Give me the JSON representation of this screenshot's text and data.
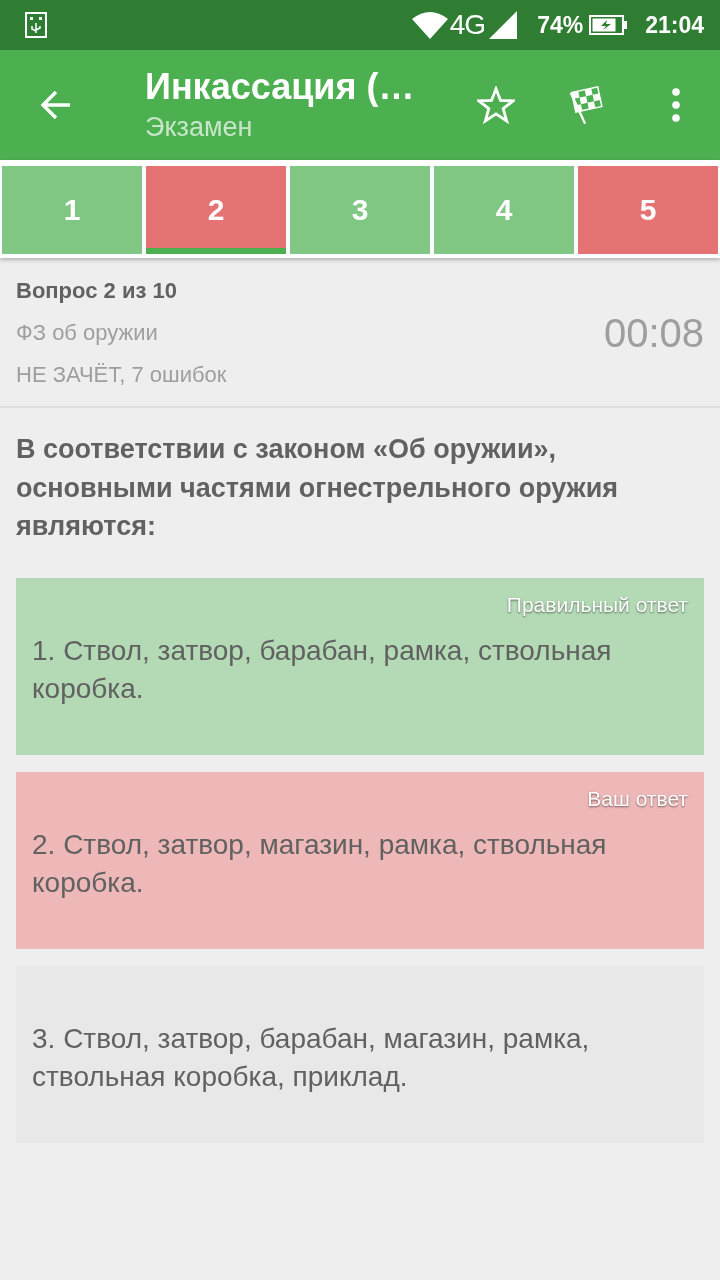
{
  "status_bar": {
    "network": "4G",
    "battery": "74%",
    "time": "21:04"
  },
  "toolbar": {
    "title": "Инкассация (…",
    "subtitle": "Экзамен"
  },
  "question_tabs": [
    {
      "label": "1",
      "kind": "correct",
      "selected": false
    },
    {
      "label": "2",
      "kind": "wrong",
      "selected": true
    },
    {
      "label": "3",
      "kind": "correct",
      "selected": false
    },
    {
      "label": "4",
      "kind": "correct",
      "selected": false
    },
    {
      "label": "5",
      "kind": "wrong",
      "selected": false
    }
  ],
  "question_info": {
    "counter": "Вопрос 2 из 10",
    "topic": "ФЗ об оружии",
    "verdict": "НЕ ЗАЧЁТ, 7 ошибок",
    "timer": "00:08"
  },
  "question": {
    "text": "В соответствии с законом «Об оружии», основными частями огнестрельного оружия являются:"
  },
  "answers": [
    {
      "kind": "correct",
      "label": "Правильный ответ",
      "text": "1. Ствол, затвор, барабан, рамка, ствольная коробка."
    },
    {
      "kind": "wrong",
      "label": "Ваш ответ",
      "text": "2. Ствол, затвор, магазин, рамка, ствольная коробка."
    },
    {
      "kind": "neutral",
      "text": "3. Ствол, затвор, барабан, магазин, рамка, ствольная коробка, приклад."
    }
  ]
}
